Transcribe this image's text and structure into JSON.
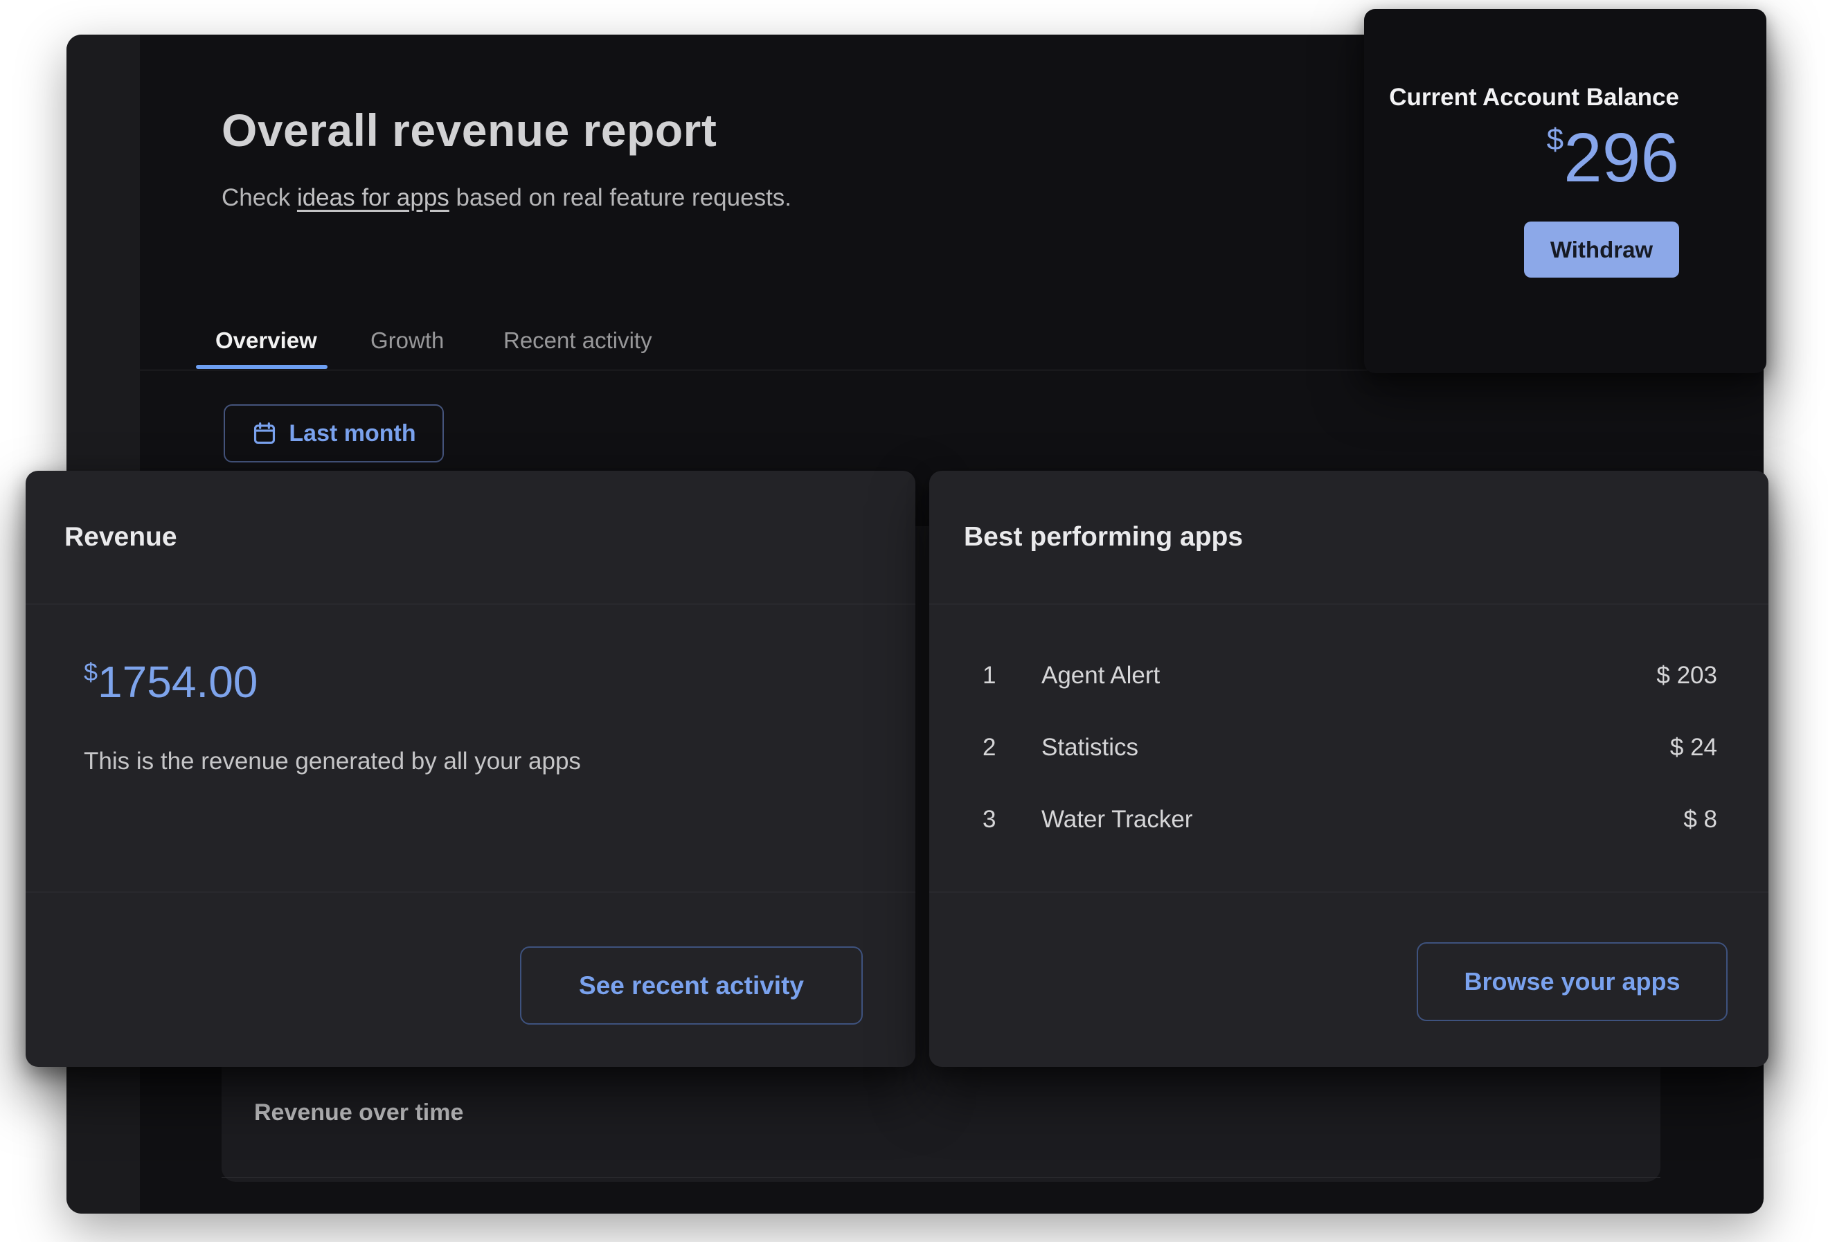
{
  "header": {
    "title": "Overall revenue report",
    "subtitle_prefix": "Check ",
    "subtitle_link": "ideas for apps",
    "subtitle_suffix": " based on real feature requests."
  },
  "balance": {
    "title": "Current Account Balance",
    "currency": "$",
    "amount": "296",
    "withdraw_label": "Withdraw"
  },
  "tabs": {
    "overview": "Overview",
    "growth": "Growth",
    "recent": "Recent activity"
  },
  "filter": {
    "date_range_label": "Last month"
  },
  "revenue": {
    "title": "Revenue",
    "currency": "$",
    "amount": "1754.00",
    "description": "This is the revenue generated by all your apps",
    "action_label": "See recent activity"
  },
  "best_apps": {
    "title": "Best performing apps",
    "rows": [
      {
        "rank": "1",
        "name": "Agent Alert",
        "amount": "$ 203"
      },
      {
        "rank": "2",
        "name": "Statistics",
        "amount": "$ 24"
      },
      {
        "rank": "3",
        "name": "Water Tracker",
        "amount": "$ 8"
      }
    ],
    "action_label": "Browse your apps"
  },
  "chart": {
    "title": "Revenue over time"
  },
  "colors": {
    "accent_blue": "#7aa2ee",
    "amount_blue": "#85a6ec",
    "button_fill": "#8ca8e8",
    "window_bg": "#101013",
    "card_bg": "#232327"
  }
}
